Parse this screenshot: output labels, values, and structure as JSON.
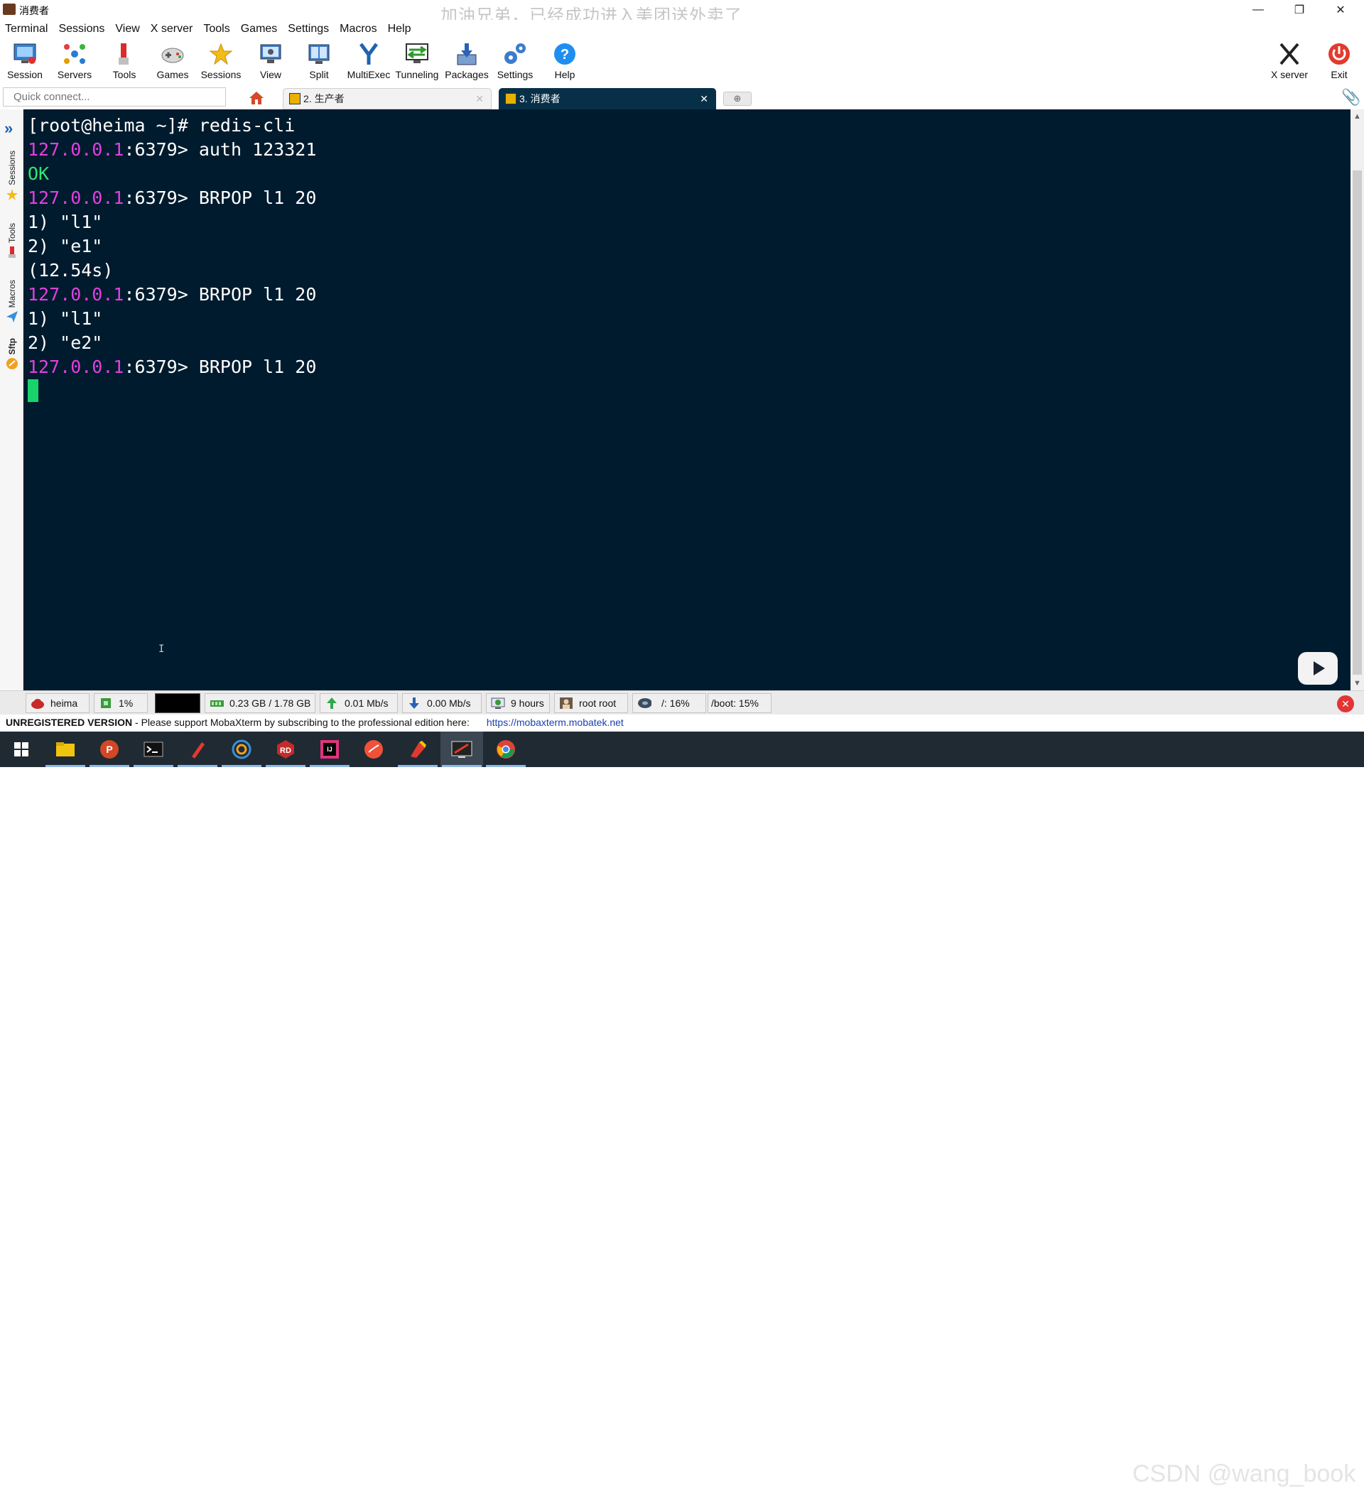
{
  "window": {
    "title": "消费者",
    "banner": "加油兄弟，已经成功进入美团送外卖了",
    "minimize": "—",
    "restore": "❐",
    "close": "✕"
  },
  "menu": [
    "Terminal",
    "Sessions",
    "View",
    "X server",
    "Tools",
    "Games",
    "Settings",
    "Macros",
    "Help"
  ],
  "toolbar": {
    "items": [
      {
        "label": "Session",
        "icon": "session-icon"
      },
      {
        "label": "Servers",
        "icon": "servers-icon"
      },
      {
        "label": "Tools",
        "icon": "tools-icon"
      },
      {
        "label": "Games",
        "icon": "games-icon"
      },
      {
        "label": "Sessions",
        "icon": "star-icon"
      },
      {
        "label": "View",
        "icon": "view-icon"
      },
      {
        "label": "Split",
        "icon": "split-icon"
      },
      {
        "label": "MultiExec",
        "icon": "multiexec-icon"
      },
      {
        "label": "Tunneling",
        "icon": "tunneling-icon"
      },
      {
        "label": "Packages",
        "icon": "packages-icon"
      },
      {
        "label": "Settings",
        "icon": "settings-icon"
      },
      {
        "label": "Help",
        "icon": "help-icon"
      }
    ],
    "xserver_label": "X server",
    "exit_label": "Exit"
  },
  "tabs": {
    "quick_connect_placeholder": "Quick connect...",
    "items": [
      {
        "label": "2. 生产者",
        "active": false
      },
      {
        "label": "3. 消费者",
        "active": true
      }
    ],
    "close_glyph": "✕",
    "new_tab_glyph": "⊕"
  },
  "sidebar": {
    "tabs": [
      "Sessions",
      "Tools",
      "Macros",
      "Sftp"
    ]
  },
  "terminal": {
    "prompt_ip": "127.0.0.1",
    "prompt_suffix": ":6379> ",
    "lines": [
      {
        "prefix": "",
        "text": "[root@heima ~]# redis-cli"
      },
      {
        "prefix": "127.0.0.1",
        "text": ":6379> auth 123321"
      },
      {
        "prefix": "",
        "text": "OK",
        "style": "ok"
      },
      {
        "prefix": "127.0.0.1",
        "text": ":6379> BRPOP l1 20"
      },
      {
        "prefix": "",
        "text": "1) \"l1\""
      },
      {
        "prefix": "",
        "text": "2) \"e1\""
      },
      {
        "prefix": "",
        "text": "(12.54s)"
      },
      {
        "prefix": "127.0.0.1",
        "text": ":6379> BRPOP l1 20"
      },
      {
        "prefix": "",
        "text": "1) \"l1\""
      },
      {
        "prefix": "",
        "text": "2) \"e2\""
      },
      {
        "prefix": "127.0.0.1",
        "text": ":6379> BRPOP l1 20"
      }
    ],
    "colors": {
      "background": "#001b2e",
      "prompt_ip": "#e040e0",
      "ok": "#2ee870",
      "cursor": "#19d36a"
    }
  },
  "status": {
    "host": "heima",
    "cpu": "1%",
    "memory": "0.23 GB / 1.78 GB",
    "upload": "0.01 Mb/s",
    "download": "0.00 Mb/s",
    "uptime": "9 hours",
    "users": "root  root",
    "disk_root": "/: 16%",
    "disk_boot": "/boot: 15%"
  },
  "footer": {
    "unregistered": "UNREGISTERED VERSION",
    "message": " -  Please support MobaXterm by subscribing to the professional edition here:",
    "link": "https://mobaxterm.mobatek.net"
  },
  "taskbar": {
    "apps": [
      "windows-start-icon",
      "file-explorer-icon",
      "powerpoint-icon",
      "terminal-icon",
      "pen-icon",
      "browser-icon",
      "redis-desktop-icon",
      "intellij-icon",
      "swift-icon",
      "paint-icon",
      "mobaxterm-icon",
      "chrome-icon"
    ]
  },
  "watermark": "CSDN @wang_book"
}
